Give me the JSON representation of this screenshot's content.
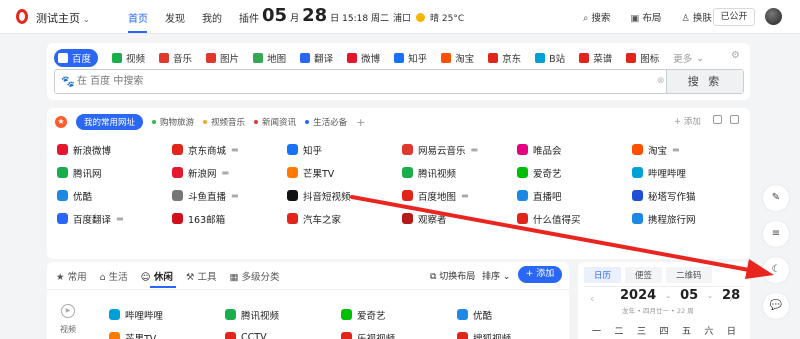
{
  "header": {
    "site_title": "测试主页",
    "nav": [
      "首页",
      "发现",
      "我的",
      "插件"
    ],
    "date_month": "05",
    "date_month_unit": "月",
    "date_day": "28",
    "date_day_unit": "日",
    "time_week": "15:18 周二",
    "city": "浦口",
    "weather": "晴 25°C",
    "tools": [
      "搜索",
      "布局",
      "换肤"
    ],
    "public_label": "已公开"
  },
  "search": {
    "engines": [
      {
        "label": "百度",
        "color": "#2a67f6"
      },
      {
        "label": "视频",
        "color": "#1aad4b"
      },
      {
        "label": "音乐",
        "color": "#e0382e"
      },
      {
        "label": "图片",
        "color": "#e0382e"
      },
      {
        "label": "地图",
        "color": "#34a853"
      },
      {
        "label": "翻译",
        "color": "#2a67f6"
      },
      {
        "label": "微博",
        "color": "#e6162d"
      },
      {
        "label": "知乎",
        "color": "#1772f6"
      },
      {
        "label": "淘宝",
        "color": "#ff5000"
      },
      {
        "label": "京东",
        "color": "#e1251b"
      },
      {
        "label": "B站",
        "color": "#00a1d6"
      },
      {
        "label": "菜谱",
        "color": "#e1251b"
      },
      {
        "label": "图标",
        "color": "#e1251b"
      }
    ],
    "more_label": "更多",
    "placeholder": "在 百度 中搜索",
    "button_label": "搜 索"
  },
  "sites": {
    "tabs": [
      {
        "label": "我的常用网址",
        "dot": ""
      },
      {
        "label": "购物旅游",
        "dot": "#39b54a"
      },
      {
        "label": "视频音乐",
        "dot": "#f5a623"
      },
      {
        "label": "新闻资讯",
        "dot": "#e0382e"
      },
      {
        "label": "生活必备",
        "dot": "#2a67f6"
      }
    ],
    "add_label": "添加",
    "items": [
      {
        "label": "新浪微博",
        "color": "#e6162d",
        "folder": false
      },
      {
        "label": "京东商城",
        "color": "#e1251b",
        "folder": true
      },
      {
        "label": "知乎",
        "color": "#1772f6",
        "folder": false
      },
      {
        "label": "网易云音乐",
        "color": "#e0382e",
        "folder": true
      },
      {
        "label": "唯品会",
        "color": "#e4007f",
        "folder": false
      },
      {
        "label": "淘宝",
        "color": "#ff5000",
        "folder": true
      },
      {
        "label": "腾讯网",
        "color": "#1aad4b",
        "folder": false
      },
      {
        "label": "新浪网",
        "color": "#e6162d",
        "folder": true
      },
      {
        "label": "芒果TV",
        "color": "#ff7a00",
        "folder": false
      },
      {
        "label": "腾讯视频",
        "color": "#1aad4b",
        "folder": false
      },
      {
        "label": "爱奇艺",
        "color": "#00be06",
        "folder": false
      },
      {
        "label": "哔哩哔哩",
        "color": "#00a1d6",
        "folder": false
      },
      {
        "label": "优酷",
        "color": "#1e88e5",
        "folder": false
      },
      {
        "label": "斗鱼直播",
        "color": "#777777",
        "folder": true
      },
      {
        "label": "抖音短视频",
        "color": "#111111",
        "folder": false
      },
      {
        "label": "百度地图",
        "color": "#e1251b",
        "folder": true
      },
      {
        "label": "直播吧",
        "color": "#1e88e5",
        "folder": false
      },
      {
        "label": "秘塔写作猫",
        "color": "#1e4fd6",
        "folder": false
      },
      {
        "label": "百度翻译",
        "color": "#2a67f6",
        "folder": true
      },
      {
        "label": "163邮箱",
        "color": "#d0111b",
        "folder": false
      },
      {
        "label": "汽车之家",
        "color": "#e1251b",
        "folder": false
      },
      {
        "label": "观察者",
        "color": "#b31a1a",
        "folder": false
      },
      {
        "label": "什么值得买",
        "color": "#e1251b",
        "folder": false
      },
      {
        "label": "携程旅行网",
        "color": "#1e88e5",
        "folder": false
      }
    ]
  },
  "categories": {
    "tabs": [
      "常用",
      "生活",
      "休闲",
      "工具",
      "多级分类"
    ],
    "layout_switch": "切换布局",
    "sort_label": "排序",
    "add_label": "添加",
    "side_label": "视频",
    "items": [
      {
        "label": "哔哩哔哩",
        "color": "#00a1d6"
      },
      {
        "label": "腾讯视频",
        "color": "#1aad4b"
      },
      {
        "label": "爱奇艺",
        "color": "#00be06"
      },
      {
        "label": "优酷",
        "color": "#1e88e5"
      },
      {
        "label": "芒果TV",
        "color": "#ff7a00"
      },
      {
        "label": "CCTV",
        "color": "#e1251b"
      },
      {
        "label": "乐视视频",
        "color": "#e1251b"
      },
      {
        "label": "搜狐视频",
        "color": "#e1251b"
      }
    ]
  },
  "calendar": {
    "tabs": [
      "日历",
      "便签",
      "二维码"
    ],
    "year": "2024",
    "month": "05",
    "day": "28",
    "lunar": "龙年 • 四月廿一 • 22 周",
    "weekdays": [
      "一",
      "二",
      "三",
      "四",
      "五",
      "六",
      "日"
    ]
  },
  "colors": {
    "accent": "#2a67f6",
    "arrow": "#e8261f",
    "brand": "#e6291f"
  }
}
